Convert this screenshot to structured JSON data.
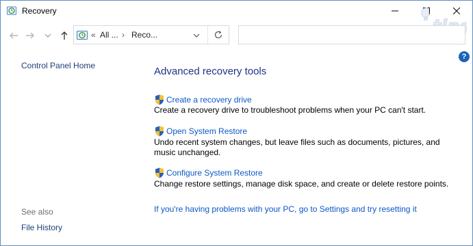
{
  "window": {
    "title": "Recovery"
  },
  "address": {
    "seg1": "All ...",
    "seg2": "Reco...",
    "chevrons": "«",
    "sep": "›"
  },
  "search": {
    "placeholder": ""
  },
  "sidebar": {
    "home": "Control Panel Home",
    "see_also": "See also",
    "file_history": "File History"
  },
  "main": {
    "heading": "Advanced recovery tools",
    "tasks": [
      {
        "link": "Create a recovery drive",
        "desc": "Create a recovery drive to troubleshoot problems when your PC can't start."
      },
      {
        "link": "Open System Restore",
        "desc": "Undo recent system changes, but leave files such as documents, pictures, and music unchanged."
      },
      {
        "link": "Configure System Restore",
        "desc": "Change restore settings, manage disk space, and create or delete restore points."
      }
    ],
    "reset_link": "If you're having problems with your PC, go to Settings and try resetting it"
  },
  "help": {
    "glyph": "?"
  },
  "colors": {
    "link": "#0b58c6",
    "heading": "#1e3287",
    "nav": "#1a3f73",
    "border": "#5f8fbf"
  }
}
